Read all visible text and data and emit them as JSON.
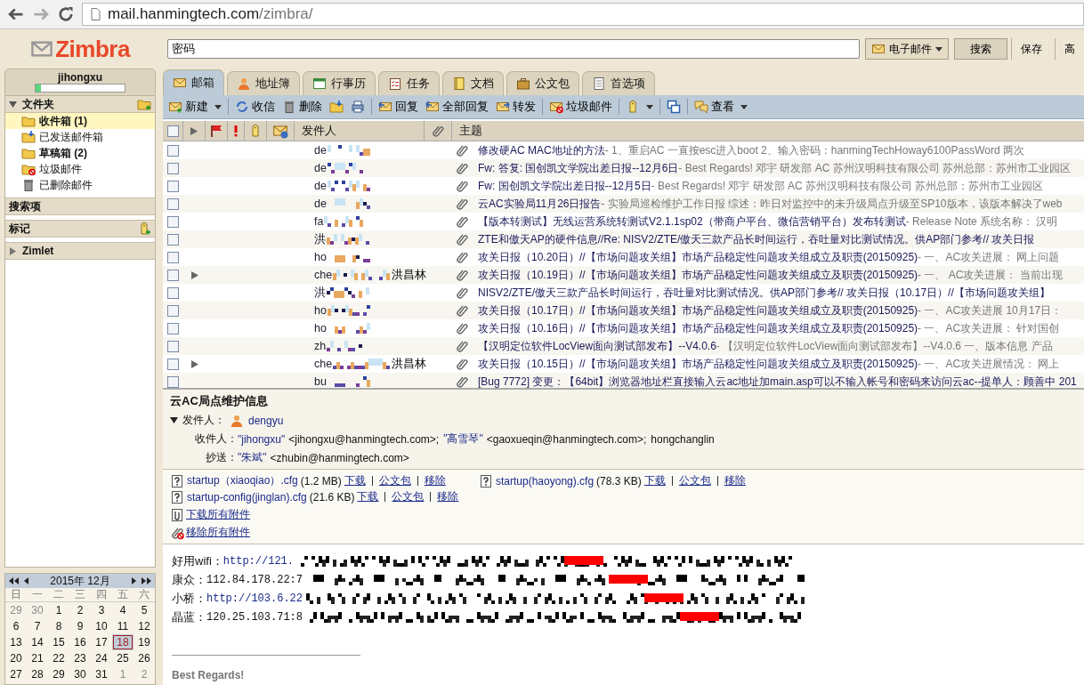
{
  "browser": {
    "url_host": "mail.hanmingtech.com",
    "url_path": "/zimbra/"
  },
  "logo": "Zimbra",
  "search": {
    "value": "密码",
    "type": "电子邮件",
    "buttons": [
      "搜索",
      "保存",
      "高"
    ]
  },
  "user": {
    "name": "jihongxu",
    "level": 0.06
  },
  "sidebar": {
    "headers": [
      {
        "kind": "toggle",
        "label": "文件夹",
        "expanded": true,
        "action": true
      }
    ],
    "folders": [
      {
        "label": "收件箱 (1)",
        "selected": true,
        "unread": true
      },
      {
        "label": "已发送邮件箱",
        "selected": false,
        "unread": false
      },
      {
        "label": "草稿箱 (2)",
        "selected": false,
        "unread": true
      },
      {
        "label": "垃圾邮件",
        "selected": false,
        "unread": false
      },
      {
        "label": "已删除邮件",
        "selected": false,
        "unread": false
      }
    ],
    "sections": [
      {
        "kind": "plain",
        "label": "搜索项",
        "action": false
      },
      {
        "kind": "plain",
        "label": "标记",
        "action": true
      },
      {
        "kind": "toggle",
        "label": "Zimlet",
        "expanded": false,
        "action": false
      }
    ]
  },
  "calendar": {
    "title": "2015年 12月",
    "weekdays": [
      "日",
      "一",
      "二",
      "三",
      "四",
      "五",
      "六"
    ],
    "weeks": [
      [
        {
          "d": "29",
          "muted": true,
          "today": false
        },
        {
          "d": "30",
          "muted": true,
          "today": false
        },
        {
          "d": "1",
          "muted": false,
          "today": false
        },
        {
          "d": "2",
          "muted": false,
          "today": false
        },
        {
          "d": "3",
          "muted": false,
          "today": false
        },
        {
          "d": "4",
          "muted": false,
          "today": false
        },
        {
          "d": "5",
          "muted": false,
          "today": false
        }
      ],
      [
        {
          "d": "6",
          "muted": false,
          "today": false
        },
        {
          "d": "7",
          "muted": false,
          "today": false
        },
        {
          "d": "8",
          "muted": false,
          "today": false
        },
        {
          "d": "9",
          "muted": false,
          "today": false
        },
        {
          "d": "10",
          "muted": false,
          "today": false
        },
        {
          "d": "11",
          "muted": false,
          "today": false
        },
        {
          "d": "12",
          "muted": false,
          "today": false
        }
      ],
      [
        {
          "d": "13",
          "muted": false,
          "today": false
        },
        {
          "d": "14",
          "muted": false,
          "today": false
        },
        {
          "d": "15",
          "muted": false,
          "today": false
        },
        {
          "d": "16",
          "muted": false,
          "today": false
        },
        {
          "d": "17",
          "muted": false,
          "today": false
        },
        {
          "d": "18",
          "muted": false,
          "today": true
        },
        {
          "d": "19",
          "muted": false,
          "today": false
        }
      ],
      [
        {
          "d": "20",
          "muted": false,
          "today": false
        },
        {
          "d": "21",
          "muted": false,
          "today": false
        },
        {
          "d": "22",
          "muted": false,
          "today": false
        },
        {
          "d": "23",
          "muted": false,
          "today": false
        },
        {
          "d": "24",
          "muted": false,
          "today": false
        },
        {
          "d": "25",
          "muted": false,
          "today": false
        },
        {
          "d": "26",
          "muted": false,
          "today": false
        }
      ],
      [
        {
          "d": "27",
          "muted": false,
          "today": false
        },
        {
          "d": "28",
          "muted": false,
          "today": false
        },
        {
          "d": "29",
          "muted": false,
          "today": false
        },
        {
          "d": "30",
          "muted": false,
          "today": false
        },
        {
          "d": "31",
          "muted": false,
          "today": false
        },
        {
          "d": "1",
          "muted": true,
          "today": false
        },
        {
          "d": "2",
          "muted": true,
          "today": false
        }
      ]
    ]
  },
  "tabs": [
    {
      "label": "邮箱",
      "selected": true
    },
    {
      "label": "地址簿",
      "selected": false
    },
    {
      "label": "行事历",
      "selected": false
    },
    {
      "label": "任务",
      "selected": false
    },
    {
      "label": "文档",
      "selected": false
    },
    {
      "label": "公文包",
      "selected": false
    },
    {
      "label": "首选项",
      "selected": false
    }
  ],
  "toolbar": [
    {
      "kind": "button",
      "label": "新建",
      "dropdown": true
    },
    {
      "kind": "separator"
    },
    {
      "kind": "button",
      "label": "收信",
      "dropdown": false
    },
    {
      "kind": "button",
      "label": "删除",
      "dropdown": false
    },
    {
      "kind": "button",
      "dropdown": false
    },
    {
      "kind": "button",
      "dropdown": false
    },
    {
      "kind": "separator"
    },
    {
      "kind": "button",
      "label": "回复",
      "dropdown": false
    },
    {
      "kind": "button",
      "label": "全部回复",
      "dropdown": false
    },
    {
      "kind": "button",
      "label": "转发",
      "dropdown": false
    },
    {
      "kind": "separator"
    },
    {
      "kind": "button",
      "label": "垃圾邮件",
      "dropdown": false
    },
    {
      "kind": "separator"
    },
    {
      "kind": "button",
      "dropdown": true
    },
    {
      "kind": "separator"
    },
    {
      "kind": "button",
      "dropdown": false
    },
    {
      "kind": "separator"
    },
    {
      "kind": "button",
      "label": "查看",
      "dropdown": true
    }
  ],
  "list_columns": {
    "sender": "发件人",
    "subject": "主题",
    "all_checked": false
  },
  "messages": [
    {
      "sender": "de",
      "subject": "修改硬AC MAC地址的方法",
      "preview": "- 1、重启AC 一直按esc进入boot 2、输入密码：hanmingTechHoway6100PassWord 两次",
      "thread": false,
      "checked": false
    },
    {
      "sender": "de",
      "subject": "Fw: 答复: 国创凯文学院出差日报--12月6日",
      "preview": "- Best Regards! 邓宇 研发部 AC 苏州汉明科技有限公司 苏州总部：苏州市工业园区",
      "thread": false,
      "checked": false
    },
    {
      "sender": "de",
      "subject": "Fw: 国创凯文学院出差日报--12月5日",
      "preview": "- Best Regards! 邓宇 研发部 AC 苏州汉明科技有限公司 苏州总部：苏州市工业园区",
      "thread": false,
      "checked": false
    },
    {
      "sender": "de",
      "subject": "云AC实验局11月26日报告",
      "preview": "- 实验局巡检维护工作日报 综述：昨日对监控中的未升级局点升级至SP10版本，该版本解决了web",
      "thread": false,
      "checked": false
    },
    {
      "sender": "fa",
      "subject": "【版本转测试】无线运营系统转测试V2.1.1sp02（带商户平台、微信营销平台）发布转测试",
      "preview": "- Release Note 系统名称： 汉明",
      "thread": false,
      "checked": false
    },
    {
      "sender": "洪",
      "subject": "ZTE和傲天AP的硬件信息//Re: NISV2/ZTE/傲天三款产品长时间运行，吞吐量对比测试情况。供AP部门参考// 攻关日报",
      "thread": false,
      "checked": false
    },
    {
      "sender": "ho",
      "subject": "攻关日报（10.20日）//【市场问题攻关组】市场产品稳定性问题攻关组成立及职责(20150925)",
      "preview": "- 一、AC攻关进展： 网上问题",
      "thread": false,
      "checked": false
    },
    {
      "sender": "che",
      "sender_extra": "洪昌林",
      "subject": "攻关日报（10.19日）//【市场问题攻关组】市场产品稳定性问题攻关组成立及职责(20150925)",
      "preview": "- 一、 AC攻关进展： 当前出现",
      "thread": true,
      "checked": false
    },
    {
      "sender": "洪",
      "subject": "NISV2/ZTE/傲天三款产品长时间运行，吞吐量对比测试情况。供AP部门参考// 攻关日报（10.17日）//【市场问题攻关组】",
      "thread": false,
      "checked": false
    },
    {
      "sender": "ho",
      "subject": "攻关日报（10.17日）//【市场问题攻关组】市场产品稳定性问题攻关组成立及职责(20150925)",
      "preview": "- 一、AC攻关进展 10月17日：",
      "thread": false,
      "checked": false
    },
    {
      "sender": "ho",
      "subject": "攻关日报（10.16日）//【市场问题攻关组】市场产品稳定性问题攻关组成立及职责(20150925)",
      "preview": "- 一、AC攻关进展： 针对国创",
      "thread": false,
      "checked": false
    },
    {
      "sender": "zh",
      "subject": "【汉明定位软件LocView面向测试部发布】--V4.0.6",
      "preview": "- 【汉明定位软件LocView面向测试部发布】--V4.0.6 一、版本信息 产品",
      "thread": false,
      "checked": false
    },
    {
      "sender": "che",
      "sender_extra": "洪昌林",
      "subject": "攻关日报（10.15日）//【市场问题攻关组】市场产品稳定性问题攻关组成立及职责(20150925)",
      "preview": "- 一、AC攻关进展情况： 网上",
      "thread": true,
      "checked": false
    },
    {
      "sender": "bu",
      "subject": "[Bug 7772] 变更：【64bit】浏览器地址栏直接输入云ac地址加main.asp可以不输入帐号和密码来访问云ac--提单人：顾善中 201",
      "thread": false,
      "checked": false
    }
  ],
  "reading": {
    "subject": "云AC局点维护信息",
    "from_label": "发件人：",
    "from": "dengyu",
    "to_label": "收件人：",
    "to": [
      {
        "name": "\"jihongxu\"",
        "email": "<jihongxu@hanmingtech.com>;"
      },
      {
        "name": "\"高雪琴\"",
        "email": "<gaoxueqin@hanmingtech.com>;"
      },
      {
        "email": "hongchanglin"
      }
    ],
    "cc_label": "抄送：",
    "cc": [
      {
        "name": "\"朱斌\"",
        "email": "<zhubin@hanmingtech.com>"
      }
    ],
    "attachments": [
      {
        "name": "startup（xiaoqiao）.cfg",
        "size": "(1.2 MB)",
        "actions": [
          "下载",
          "公文包",
          "移除"
        ]
      },
      {
        "name": "startup(haoyong).cfg",
        "size": "(78.3 KB)",
        "actions": [
          "下载",
          "公文包",
          "移除"
        ]
      },
      {
        "name": "startup-config(jinglan).cfg",
        "size": "(21.6 KB)",
        "actions": [
          "下载",
          "公文包",
          "移除"
        ]
      }
    ],
    "download_all": "下载所有附件",
    "remove_all": "移除所有附件",
    "body": [
      {
        "label": "好用wifi：",
        "value": "http://121.",
        "link": true
      },
      {
        "label": "康众：",
        "value": "112.84.178.22:7",
        "link": false
      },
      {
        "label": "小桥：",
        "value": "http://103.6.22",
        "link": true
      },
      {
        "label": "晶蓝：",
        "value": "120.25.103.71:8",
        "link": false
      }
    ],
    "signature": "Best Regards!"
  }
}
